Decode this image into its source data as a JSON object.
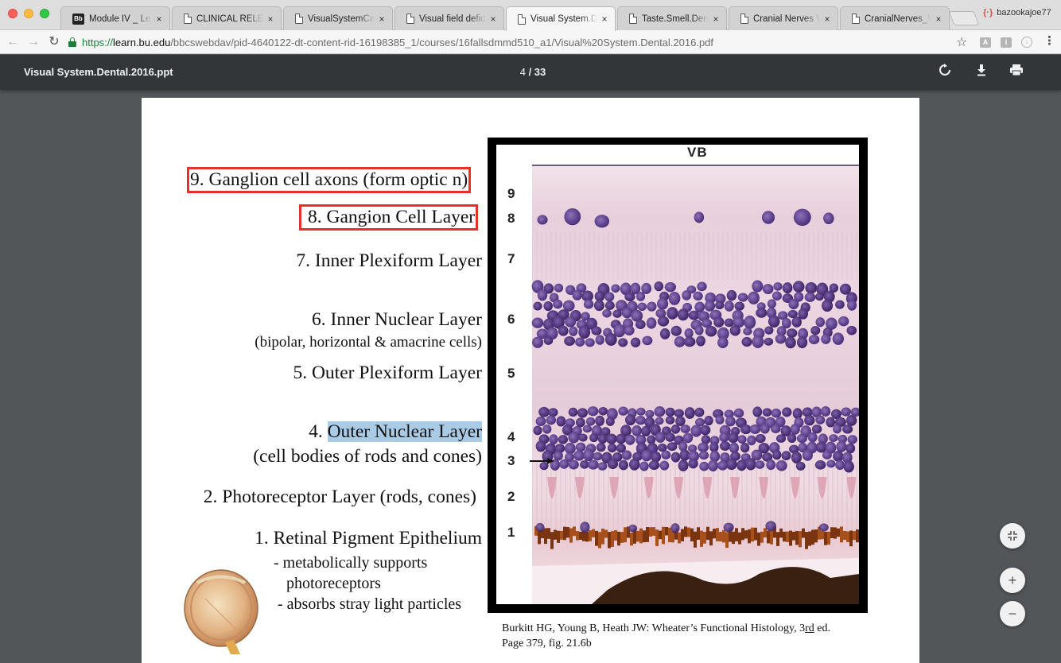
{
  "browser": {
    "tabs": [
      {
        "title": "Module IV _ Lect",
        "favicon": "blackboard-icon",
        "active": false
      },
      {
        "title": "CLINICAL RELEV",
        "favicon": "document-icon",
        "active": false
      },
      {
        "title": "VisualSystemCas",
        "favicon": "document-icon",
        "active": false
      },
      {
        "title": "Visual field defic",
        "favicon": "document-icon",
        "active": false
      },
      {
        "title": "Visual System.De",
        "favicon": "document-icon",
        "active": true
      },
      {
        "title": "Taste.Smell.Dent",
        "favicon": "document-icon",
        "active": false
      },
      {
        "title": "Cranial Nerves V",
        "favicon": "document-icon",
        "active": false
      },
      {
        "title": "CranialNerves_V",
        "favicon": "document-icon",
        "active": false
      }
    ],
    "favicon_bb": "Bb",
    "close_glyph": "×",
    "profile_name": "bazookajoe77",
    "url": {
      "scheme": "https://",
      "host": "learn.bu.edu",
      "path": "/bbcswebdav/pid-4640122-dt-content-rid-16198385_1/courses/16fallsdmmd510_a1/Visual%20System.Dental.2016.pdf"
    },
    "ext_a": "A",
    "ext_b": "i",
    "ext_c": "↓"
  },
  "pdf_viewer": {
    "title": "Visual System.Dental.2016.ppt",
    "page_current": "4",
    "page_sep": " / ",
    "page_total": "33"
  },
  "slide": {
    "labels": {
      "l9": "9. Ganglion cell axons (form optic n)",
      "l8": "8. Gangion Cell Layer",
      "l7": "7. Inner Plexiform Layer",
      "l6": "6. Inner Nuclear Layer",
      "l6_sub": "(bipolar, horizontal & amacrine cells)",
      "l5": "5. Outer Plexiform Layer",
      "l4_prefix": "4. ",
      "l4_highlight": "Outer Nuclear Layer",
      "l4_sub": "(cell bodies of rods and cones)",
      "l2": "2. Photoreceptor Layer (rods, cones)",
      "l1": "1. Retinal Pigment Epithelium",
      "l1_b1": "- metabolically supports",
      "l1_b1b": "photoreceptors",
      "l1_b2": "- absorbs stray light particles"
    },
    "micrograph": {
      "top_label": "VB",
      "numbers": [
        "9",
        "8",
        "7",
        "6",
        "5",
        "4",
        "3",
        "2",
        "1"
      ]
    },
    "citation": {
      "line1_a": "Burkitt HG, Young B, Heath JW: Wheater",
      "line1_apos": "’",
      "line1_b": "s Functional Histology, 3",
      "line1_sup": "rd",
      "line1_c": " ed.",
      "line2": "Page 379, fig. 21.6b"
    }
  },
  "colors": {
    "highlight_box": "#e8302a",
    "text_highlight": "#a9cbe6",
    "viewer_bg": "#525659",
    "viewer_toolbar": "#323639"
  }
}
